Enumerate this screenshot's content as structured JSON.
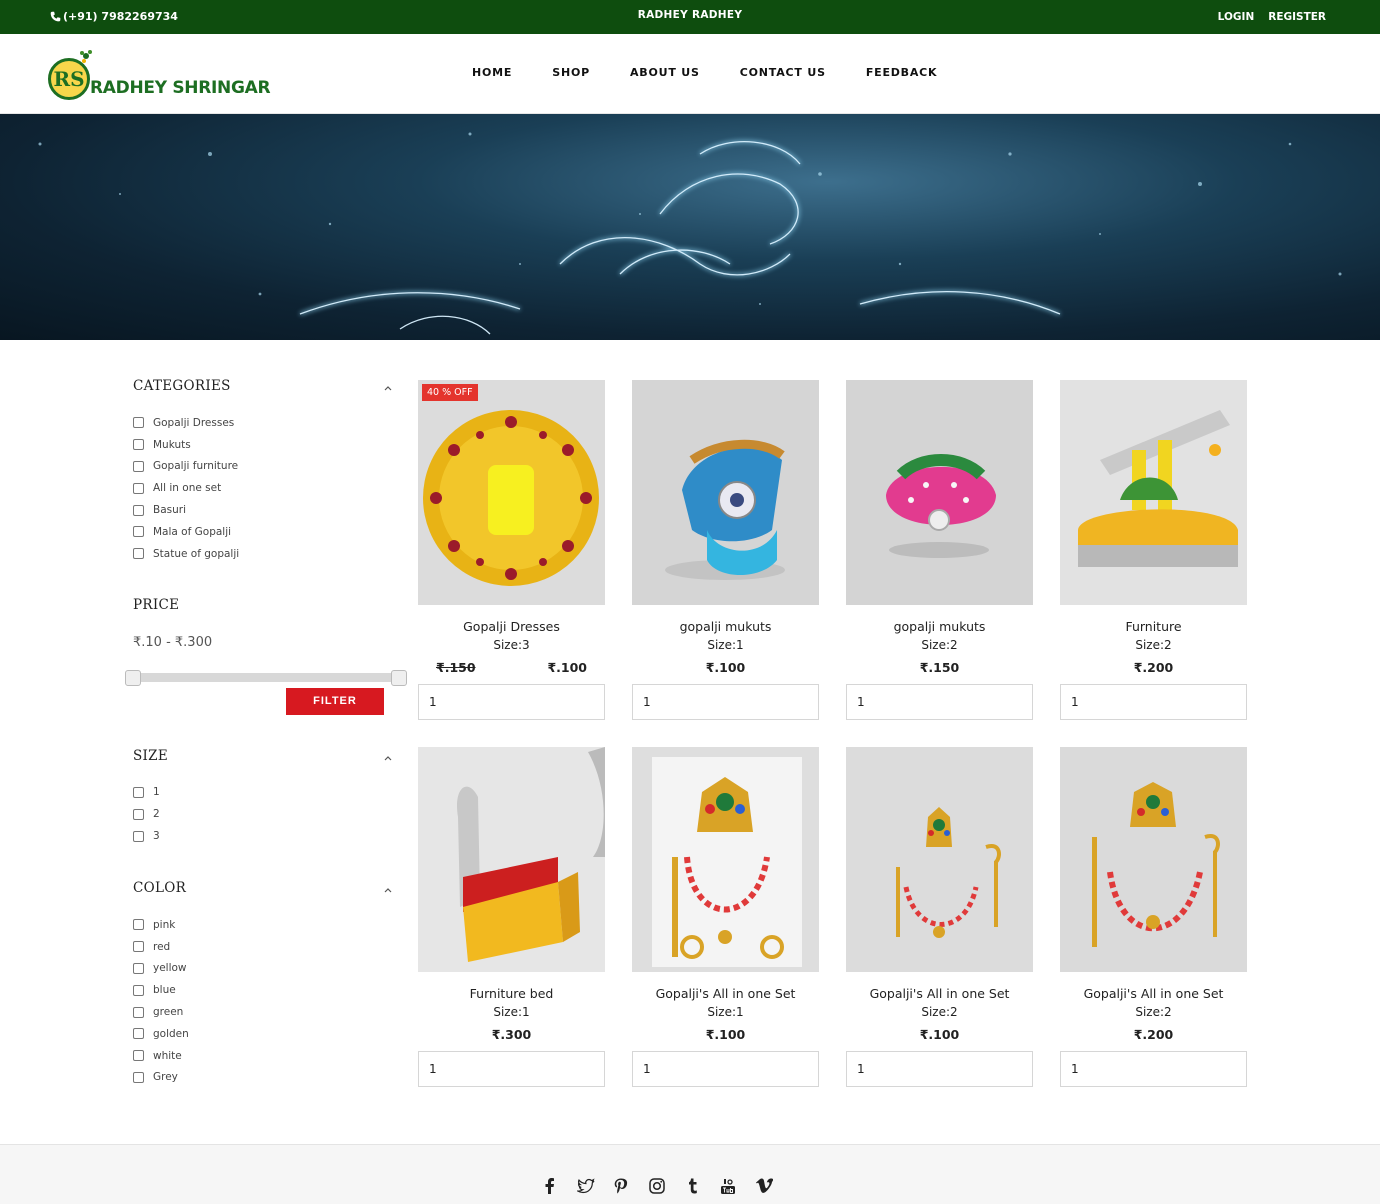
{
  "topbar": {
    "phone": "(+91) 7982269734",
    "center_text": "RADHEY RADHEY",
    "login": "LOGIN",
    "register": "REGISTER"
  },
  "header": {
    "logo_text": "RADHEY SHRINGAR",
    "logo_mark": "RS",
    "nav": [
      "HOME",
      "SHOP",
      "ABOUT US",
      "CONTACT US",
      "FEEDBACK"
    ]
  },
  "sidebar": {
    "categories": {
      "title": "CATEGORIES",
      "items": [
        "Gopalji Dresses",
        "Mukuts",
        "Gopalji furniture",
        "All in one set",
        "Basuri",
        "Mala of Gopalji",
        "Statue of gopalji"
      ]
    },
    "price": {
      "title": "PRICE",
      "range_text": "₹.10 - ₹.300",
      "min": 10,
      "max": 300,
      "filter_label": "FILTER"
    },
    "size": {
      "title": "SIZE",
      "items": [
        "1",
        "2",
        "3"
      ]
    },
    "color": {
      "title": "COLOR",
      "items": [
        "pink",
        "red",
        "yellow",
        "blue",
        "green",
        "golden",
        "white",
        "Grey"
      ]
    }
  },
  "products": [
    {
      "name": "Gopalji Dresses",
      "size": "Size:3",
      "old_price": "₹.150",
      "price": "₹.100",
      "badge": "40 % OFF",
      "qty": "1",
      "icon": "dress-image"
    },
    {
      "name": "gopalji mukuts",
      "size": "Size:1",
      "price": "₹.100",
      "qty": "1",
      "icon": "blue-mukut-image"
    },
    {
      "name": "gopalji mukuts",
      "size": "Size:2",
      "price": "₹.150",
      "qty": "1",
      "icon": "pink-mukut-image"
    },
    {
      "name": "Furniture",
      "size": "Size:2",
      "price": "₹.200",
      "qty": "1",
      "icon": "swing-image"
    },
    {
      "name": "Furniture bed",
      "size": "Size:1",
      "price": "₹.300",
      "qty": "1",
      "icon": "bed-image"
    },
    {
      "name": "Gopalji's All in one Set",
      "size": "Size:1",
      "price": "₹.100",
      "qty": "1",
      "icon": "jewelry-set-image"
    },
    {
      "name": "Gopalji's All in one Set",
      "size": "Size:2",
      "price": "₹.100",
      "qty": "1",
      "icon": "jewelry-set-image"
    },
    {
      "name": "Gopalji's All in one Set",
      "size": "Size:2",
      "price": "₹.200",
      "qty": "1",
      "icon": "jewelry-set-image"
    }
  ],
  "footer": {
    "social": [
      "facebook-icon",
      "twitter-icon",
      "pinterest-icon",
      "instagram-icon",
      "tumblr-icon",
      "youtube-icon",
      "vimeo-icon"
    ]
  },
  "colors": {
    "topbar": "#0e4d0e",
    "brand_green": "#1d6e22",
    "filter_red": "#d71920",
    "badge_red": "#e4342d"
  }
}
